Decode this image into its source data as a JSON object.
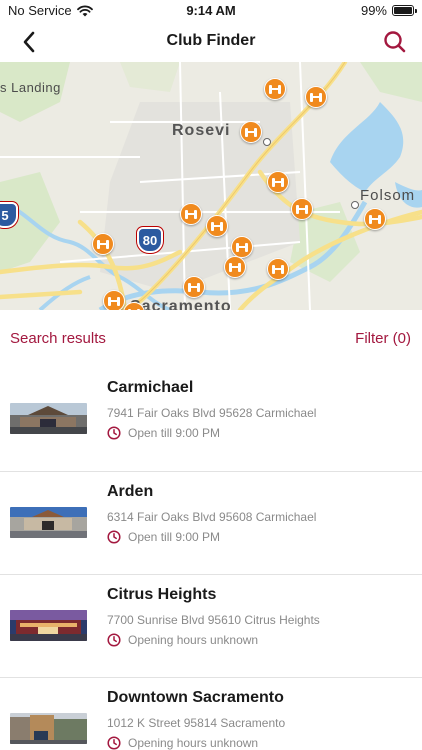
{
  "status_bar": {
    "carrier": "No Service",
    "time": "9:14 AM",
    "battery": "99%",
    "battery_level": 0.99
  },
  "nav": {
    "title": "Club Finder",
    "back_icon": "chevron-left-icon",
    "search_icon": "search-icon"
  },
  "map": {
    "labels": {
      "landing": "s Landing",
      "roseville": "Rosevi",
      "folsom": "Folsom",
      "sacramento": "Sacramento"
    },
    "shields": {
      "interstate_80": "80",
      "route_5": "5"
    },
    "pin_icon": "dumbbell-icon"
  },
  "colors": {
    "accent": "#a3183f",
    "pin": "#f08a1e",
    "water": "#a8d4f0",
    "road": "#f7e08a"
  },
  "results": {
    "title": "Search results",
    "filter": "Filter (0)",
    "items": [
      {
        "name": "Carmichael",
        "address": "7941 Fair Oaks Blvd 95628 Carmichael",
        "hours": "Open till 9:00 PM"
      },
      {
        "name": "Arden",
        "address": "6314 Fair Oaks Blvd 95608 Carmichael",
        "hours": "Open till 9:00 PM"
      },
      {
        "name": "Citrus Heights",
        "address": "7700 Sunrise Blvd 95610 Citrus Heights",
        "hours": "Opening hours unknown"
      },
      {
        "name": "Downtown Sacramento",
        "address": "1012 K Street 95814 Sacramento",
        "hours": "Opening hours unknown"
      }
    ]
  }
}
